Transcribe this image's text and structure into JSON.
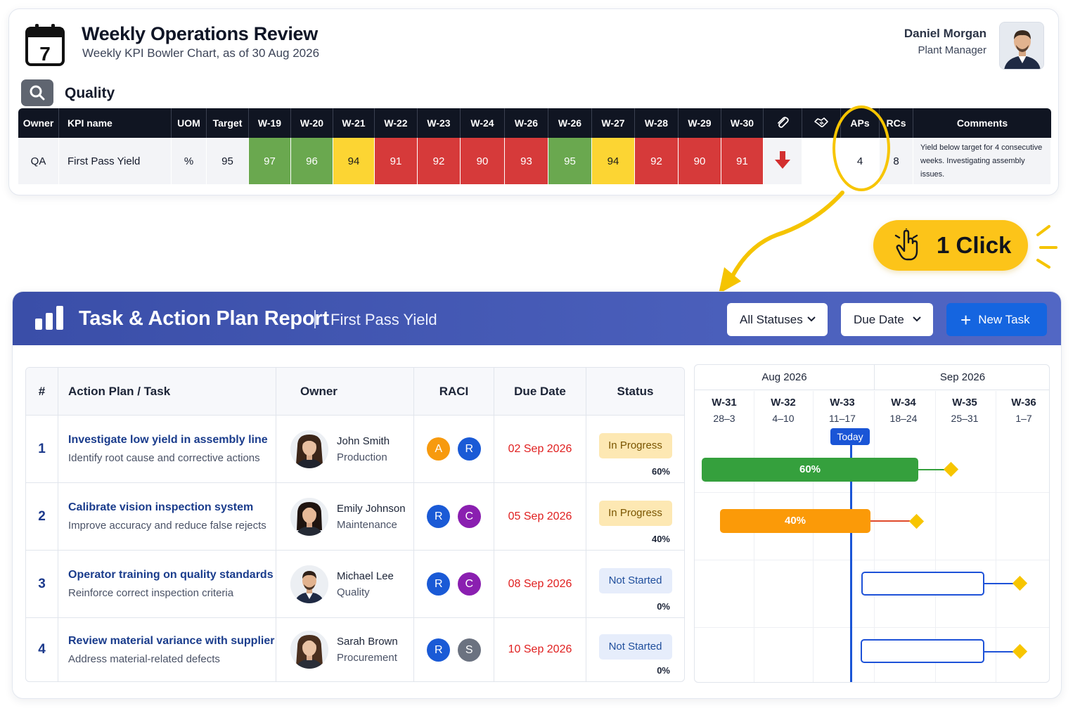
{
  "header": {
    "title": "Weekly Operations Review",
    "subtitle": "Weekly KPI Bowler Chart, as of 30 Aug 2026",
    "calendar_day": "7",
    "user_name": "Daniel Morgan",
    "user_role": "Plant Manager"
  },
  "section": {
    "label": "Quality"
  },
  "kpi_table": {
    "headers": {
      "owner": "Owner",
      "kpi": "KPI name",
      "uom": "UOM",
      "target": "Target",
      "aps": "APs",
      "rcs": "RCs",
      "comments": "Comments"
    },
    "weeks": [
      "W-19",
      "W-20",
      "W-21",
      "W-22",
      "W-23",
      "W-24",
      "W-26",
      "W-26",
      "W-27",
      "W-28",
      "W-29",
      "W-30"
    ],
    "row": {
      "owner": "QA",
      "kpi": "First Pass Yield",
      "uom": "%",
      "target": "95",
      "values": [
        97,
        96,
        94,
        91,
        92,
        90,
        93,
        95,
        94,
        92,
        90,
        91
      ],
      "status_colors": [
        "green",
        "green",
        "yellow",
        "red",
        "red",
        "red",
        "red",
        "green",
        "yellow",
        "red",
        "red",
        "red"
      ],
      "trend": "down-arrow-icon",
      "aps": "4",
      "rcs": "8",
      "comment": "Yield below target for 4 consecutive weeks. Investigating assembly issues."
    }
  },
  "click_badge": {
    "label": "1 Click"
  },
  "report": {
    "title": "Task & Action Plan Report",
    "kpi": "First Pass Yield",
    "filter_status": "All Statuses",
    "filter_due": "Due Date",
    "new_task": "New Task",
    "columns": {
      "num": "#",
      "task": "Action Plan / Task",
      "owner": "Owner",
      "raci": "RACI",
      "due": "Due Date",
      "status": "Status"
    },
    "tasks": [
      {
        "num": "1",
        "title": "Investigate low yield in assembly line",
        "desc": "Identify root cause and corrective actions",
        "owner": "John Smith",
        "dept": "Production",
        "raci": [
          "A",
          "R"
        ],
        "due": "02 Sep 2026",
        "status": "In Progress",
        "pct": "60%"
      },
      {
        "num": "2",
        "title": "Calibrate vision inspection system",
        "desc": "Improve accuracy and reduce false rejects",
        "owner": "Emily Johnson",
        "dept": "Maintenance",
        "raci": [
          "R",
          "C"
        ],
        "due": "05 Sep 2026",
        "status": "In Progress",
        "pct": "40%"
      },
      {
        "num": "3",
        "title": "Operator training on quality standards",
        "desc": "Reinforce correct inspection criteria",
        "owner": "Michael Lee",
        "dept": "Quality",
        "raci": [
          "R",
          "C"
        ],
        "due": "08 Sep 2026",
        "status": "Not Started",
        "pct": "0%"
      },
      {
        "num": "4",
        "title": "Review material variance with supplier",
        "desc": "Address material-related defects",
        "owner": "Sarah Brown",
        "dept": "Procurement",
        "raci": [
          "R",
          "S"
        ],
        "due": "10 Sep 2026",
        "status": "Not Started",
        "pct": "0%"
      }
    ]
  },
  "gantt": {
    "months": [
      "Aug 2026",
      "Sep 2026"
    ],
    "weeks": [
      {
        "wk": "W-31",
        "range": "28–3"
      },
      {
        "wk": "W-32",
        "range": "4–10"
      },
      {
        "wk": "W-33",
        "range": "11–17"
      },
      {
        "wk": "W-34",
        "range": "18–24"
      },
      {
        "wk": "W-35",
        "range": "25–31"
      },
      {
        "wk": "W-36",
        "range": "1–7"
      }
    ],
    "today_label": "Today",
    "bars": [
      {
        "label": "60%",
        "progress": 0.6
      },
      {
        "label": "40%",
        "progress": 0.4
      },
      {
        "label": "",
        "progress": 0
      },
      {
        "label": "",
        "progress": 0
      }
    ]
  },
  "colors": {
    "green": "#6aa84f",
    "yellow": "#fcd533",
    "red": "#d63a3a",
    "header_bg": "#101522",
    "report_blue": "#3a4ea8",
    "accent": "#1565e0",
    "raci_A": "#f79a0e",
    "raci_R": "#1a5ad6",
    "raci_C": "#8a1fb0",
    "raci_S": "#6b7280"
  }
}
